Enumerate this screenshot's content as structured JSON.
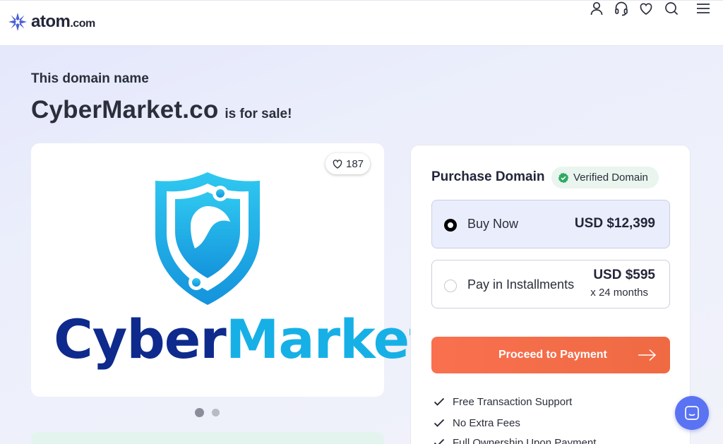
{
  "brand": {
    "name": "atom",
    "tld": ".com"
  },
  "header": {
    "icons": [
      "user-icon",
      "headset-icon",
      "heart-icon",
      "search-icon",
      "menu-icon"
    ]
  },
  "hero": {
    "subtitle": "This domain name",
    "domain": "CyberMarket.co",
    "suffix": "is for sale!"
  },
  "listing": {
    "likes": "187",
    "logo_word_1": "Cyber",
    "logo_word_2": "Market",
    "carousel_pages": 2,
    "carousel_active": 1
  },
  "purchase": {
    "title": "Purchase Domain",
    "badge": "Verified Domain",
    "options": [
      {
        "label": "Buy Now",
        "price": "USD $12,399",
        "selected": true
      },
      {
        "label": "Pay in Installments",
        "price": "USD $595",
        "sub": "x 24 months",
        "selected": false
      }
    ],
    "cta": "Proceed to Payment",
    "features": [
      "Free Transaction Support",
      "No Extra Fees",
      "Full Ownership Upon Payment"
    ]
  },
  "colors": {
    "accent": "#5a73f2",
    "cta": "#f46c4a",
    "verified": "#2eaa62",
    "logo_dark": "#0e2a8c",
    "logo_light": "#17b0e6"
  }
}
